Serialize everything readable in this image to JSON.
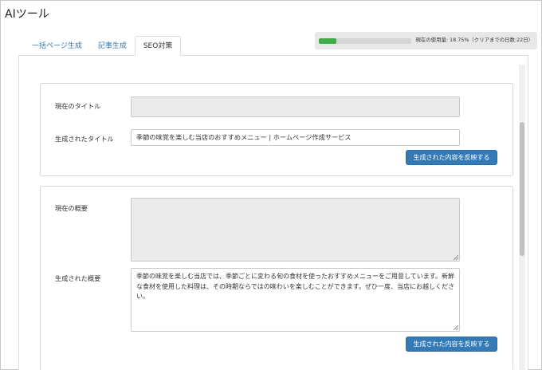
{
  "app": {
    "title": "AIツール"
  },
  "tabs": [
    {
      "label": "一括ページ生成",
      "active": false
    },
    {
      "label": "記事生成",
      "active": false
    },
    {
      "label": "SEO対策",
      "active": true
    }
  ],
  "usage": {
    "text": "現在の使用量: 18.75%（クリアまでの日数:22日）",
    "percent": 18.75,
    "bar_color": "#3fae49"
  },
  "title_section": {
    "current_label": "現在のタイトル",
    "current_value": "",
    "generated_label": "生成されたタイトル",
    "generated_value": "季節の味覚を楽しむ当店のおすすめメニュー | ホームページ作成サービス",
    "apply_button": "生成された内容を反映する"
  },
  "summary_section": {
    "current_label": "現在の概要",
    "current_value": "",
    "generated_label": "生成された概要",
    "generated_value": "季節の味覚を楽しむ当店では、季節ごとに変わる旬の食材を使ったおすすめメニューをご用意しています。新鮮な食材を使用した料理は、その時期ならではの味わいを楽しむことができます。ぜひ一度、当店にお越しください。",
    "apply_button": "生成された内容を反映する"
  },
  "colors": {
    "primary": "#337ab7",
    "tab_link": "#337ab7",
    "readonly_bg": "#ebebeb"
  }
}
